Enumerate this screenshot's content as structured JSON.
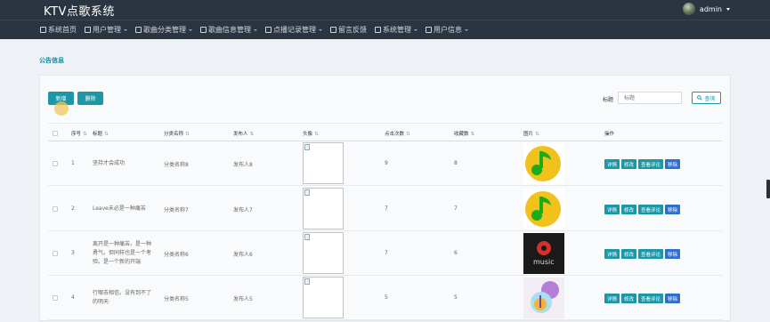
{
  "app": {
    "title": "KTV点歌系统"
  },
  "user": {
    "name": "admin"
  },
  "nav": {
    "items": [
      {
        "label": "系统首页",
        "icon": "home-icon",
        "has_dropdown": false
      },
      {
        "label": "用户管理",
        "icon": "user-icon",
        "has_dropdown": true
      },
      {
        "label": "歌曲分类管理",
        "icon": "category-icon",
        "has_dropdown": true
      },
      {
        "label": "歌曲信息管理",
        "icon": "grid-icon",
        "has_dropdown": true
      },
      {
        "label": "点播记录管理",
        "icon": "tags-icon",
        "has_dropdown": true
      },
      {
        "label": "留言反馈",
        "icon": "message-icon",
        "has_dropdown": false
      },
      {
        "label": "系统管理",
        "icon": "apps-icon",
        "has_dropdown": true
      },
      {
        "label": "用户信息",
        "icon": "monitor-icon",
        "has_dropdown": true
      }
    ]
  },
  "page": {
    "title": "公告信息"
  },
  "toolbar": {
    "add_label": "新增",
    "delete_label": "删除"
  },
  "search": {
    "label": "标题",
    "placeholder": "标题",
    "button_label": "查询"
  },
  "table": {
    "columns": [
      "序号",
      "标题",
      "分类名称",
      "发布人",
      "头像",
      "点击次数",
      "收藏数",
      "图片",
      "操作"
    ],
    "sortable": [
      true,
      true,
      true,
      true,
      true,
      true,
      true,
      true,
      false
    ],
    "actions": [
      "详情",
      "修改",
      "查看评论",
      "移除"
    ],
    "rows": [
      {
        "index": "1",
        "title": [
          "坚持才会成功"
        ],
        "category": "分类名称8",
        "publisher": "发布人8",
        "clicks": "9",
        "favorites": "8",
        "image": "qq-music-logo"
      },
      {
        "index": "2",
        "title": [
          "Leave未必是一种痛苦"
        ],
        "category": "分类名称7",
        "publisher": "发布人7",
        "clicks": "7",
        "favorites": "7",
        "image": "qq-music-logo"
      },
      {
        "index": "3",
        "title": [
          "离开是一种痛苦。是一种",
          "勇气。但同样也是一个考",
          "验。是一个新的开端"
        ],
        "category": "分类名称6",
        "publisher": "发布人6",
        "clicks": "7",
        "favorites": "6",
        "image": "music-app-logo"
      },
      {
        "index": "4",
        "title": [
          "行哪去相信。没有到不了",
          "的明天"
        ],
        "category": "分类名称5",
        "publisher": "发布人5",
        "clicks": "5",
        "favorites": "5",
        "image": "music-cartoon"
      }
    ]
  },
  "colors": {
    "topbar": "#2b3542",
    "accent": "#1d97a6",
    "remove_button": "#2e6fd1",
    "page_bg": "#eef1f5"
  }
}
